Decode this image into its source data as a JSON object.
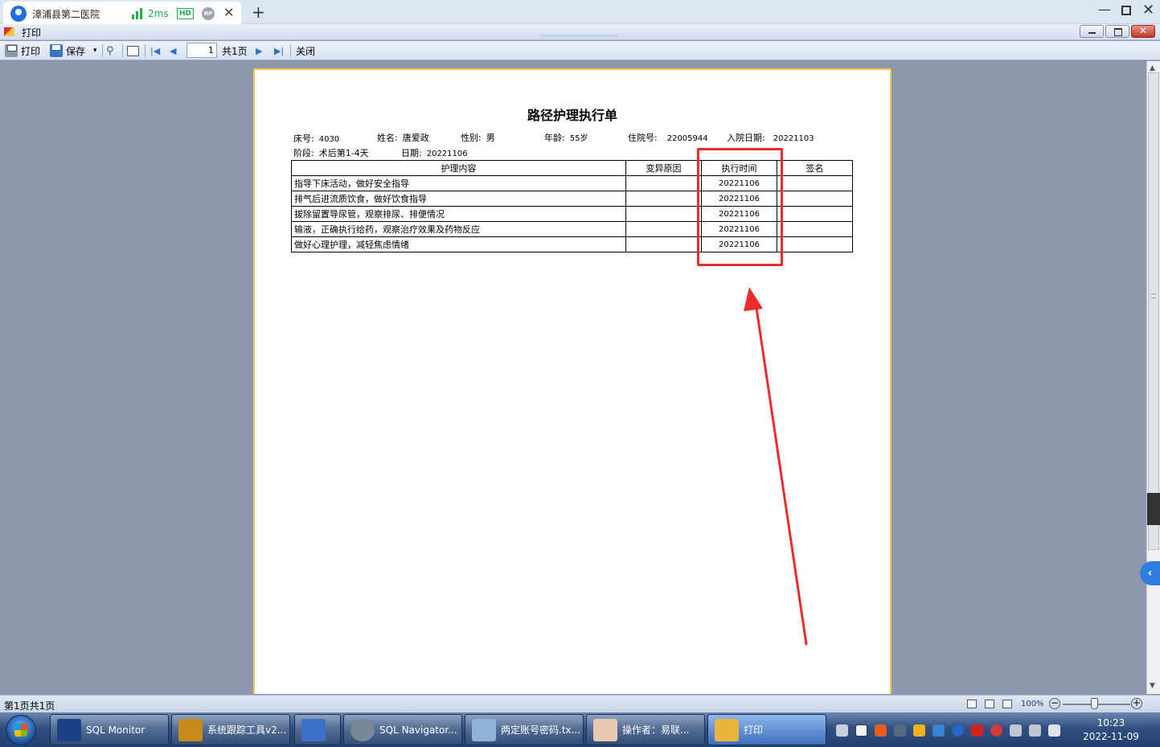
{
  "remote": {
    "tab_title": "漳浦县第二医院",
    "ping": "2ms",
    "hd": "HD",
    "rp": "RP"
  },
  "window": {
    "title": "打印"
  },
  "toolbar": {
    "print": "打印",
    "save": "保存",
    "page_value": "1",
    "total_pages": "共1页",
    "close": "关闭"
  },
  "document": {
    "title": "路径护理执行单",
    "fields": {
      "bed_label": "床号:",
      "bed": "4030",
      "name_label": "姓名:",
      "name": "唐爱政",
      "sex_label": "性别:",
      "sex": "男",
      "age_label": "年龄:",
      "age": "55岁",
      "admission_no_label": "住院号:",
      "admission_no": "22005944",
      "admit_date_label": "入院日期:",
      "admit_date": "20221103",
      "stage_label": "阶段:",
      "stage": "术后第1-4天",
      "date_label": "日期:",
      "date": "20221106"
    },
    "table": {
      "headers": [
        "护理内容",
        "变异原因",
        "执行时间",
        "签名"
      ],
      "rows": [
        {
          "content": "指导下床活动，做好安全指导",
          "variance": "",
          "time": "20221106",
          "sign": ""
        },
        {
          "content": "排气后进流质饮食，做好饮食指导",
          "variance": "",
          "time": "20221106",
          "sign": ""
        },
        {
          "content": "拔除留置导尿管，观察排尿、排便情况",
          "variance": "",
          "time": "20221106",
          "sign": ""
        },
        {
          "content": "输液，正确执行给药，观察治疗效果及药物反应",
          "variance": "",
          "time": "20221106",
          "sign": ""
        },
        {
          "content": "做好心理护理，减轻焦虑情绪",
          "variance": "",
          "time": "20221106",
          "sign": ""
        }
      ]
    }
  },
  "annotation": {
    "color": "#ee2b2b"
  },
  "statusbar": {
    "page_info": "第1页共1页",
    "zoom": "100%"
  },
  "taskbar": {
    "items": [
      {
        "label": "SQL Monitor",
        "color": "#1d3f86"
      },
      {
        "label": "系统跟踪工具v2...",
        "color": "#c88a1a"
      },
      {
        "label": "",
        "color": "#3c6fc8"
      },
      {
        "label": "SQL Navigator...",
        "color": "#7a8794"
      },
      {
        "label": "两定账号密码.tx...",
        "color": "#8fb3d6"
      },
      {
        "label": "操作者：易联...",
        "color": "#e7c9b2"
      },
      {
        "label": "打印",
        "color": "#e8b43a"
      }
    ],
    "time": "10:23",
    "date": "2022-11-09"
  }
}
